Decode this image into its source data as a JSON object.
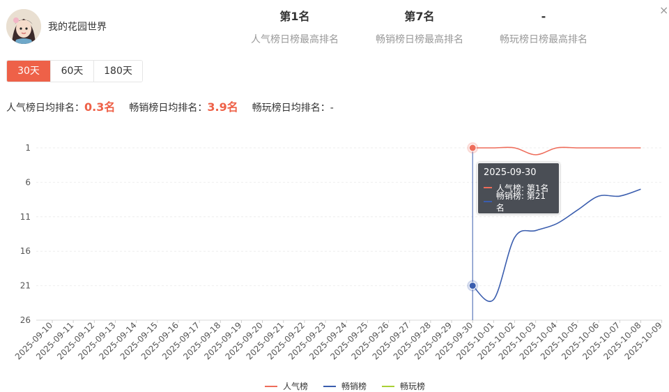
{
  "app": {
    "name": "我的花园世界"
  },
  "stats": [
    {
      "value": "第1名",
      "label": "人气榜日榜最高排名"
    },
    {
      "value": "第7名",
      "label": "畅销榜日榜最高排名"
    },
    {
      "value": "-",
      "label": "畅玩榜日榜最高排名"
    }
  ],
  "close_label": "×",
  "tabs": [
    {
      "label": "30天",
      "active": true
    },
    {
      "label": "60天",
      "active": false
    },
    {
      "label": "180天",
      "active": false
    }
  ],
  "averages": [
    {
      "label": "人气榜日均排名：",
      "value": "0.3名"
    },
    {
      "label": "畅销榜日均排名：",
      "value": "3.9名"
    },
    {
      "label": "畅玩榜日均排名：",
      "value": "-"
    }
  ],
  "tooltip": {
    "date": "2025-09-30",
    "rows": [
      {
        "text": "人气榜: 第1名"
      },
      {
        "text": "畅销榜: 第21名"
      }
    ]
  },
  "chart_data": {
    "type": "line",
    "y_inverted": true,
    "ylim": [
      1,
      26
    ],
    "y_ticks": [
      "1",
      "6",
      "11",
      "16",
      "21",
      "26"
    ],
    "x": [
      "2025-09-10",
      "2025-09-11",
      "2025-09-12",
      "2025-09-13",
      "2025-09-14",
      "2025-09-15",
      "2025-09-16",
      "2025-09-17",
      "2025-09-18",
      "2025-09-19",
      "2025-09-20",
      "2025-09-21",
      "2025-09-22",
      "2025-09-23",
      "2025-09-24",
      "2025-09-25",
      "2025-09-26",
      "2025-09-27",
      "2025-09-28",
      "2025-09-29",
      "2025-09-30",
      "2025-10-01",
      "2025-10-02",
      "2025-10-03",
      "2025-10-04",
      "2025-10-05",
      "2025-10-06",
      "2025-10-07",
      "2025-10-08",
      "2025-10-09"
    ],
    "series": [
      {
        "name": "人气榜",
        "color": "#ee6c5a",
        "values": [
          null,
          null,
          null,
          null,
          null,
          null,
          null,
          null,
          null,
          null,
          null,
          null,
          null,
          null,
          null,
          null,
          null,
          null,
          null,
          null,
          1,
          1,
          1,
          2,
          1,
          1,
          1,
          1,
          1,
          null
        ]
      },
      {
        "name": "畅销榜",
        "color": "#3a5dae",
        "values": [
          null,
          null,
          null,
          null,
          null,
          null,
          null,
          null,
          null,
          null,
          null,
          null,
          null,
          null,
          null,
          null,
          null,
          null,
          null,
          null,
          21,
          23,
          14,
          13,
          12,
          10,
          8,
          8,
          7,
          null
        ]
      },
      {
        "name": "畅玩榜",
        "color": "#a9d134",
        "values": []
      }
    ],
    "highlight_index": 20,
    "grid": true
  }
}
